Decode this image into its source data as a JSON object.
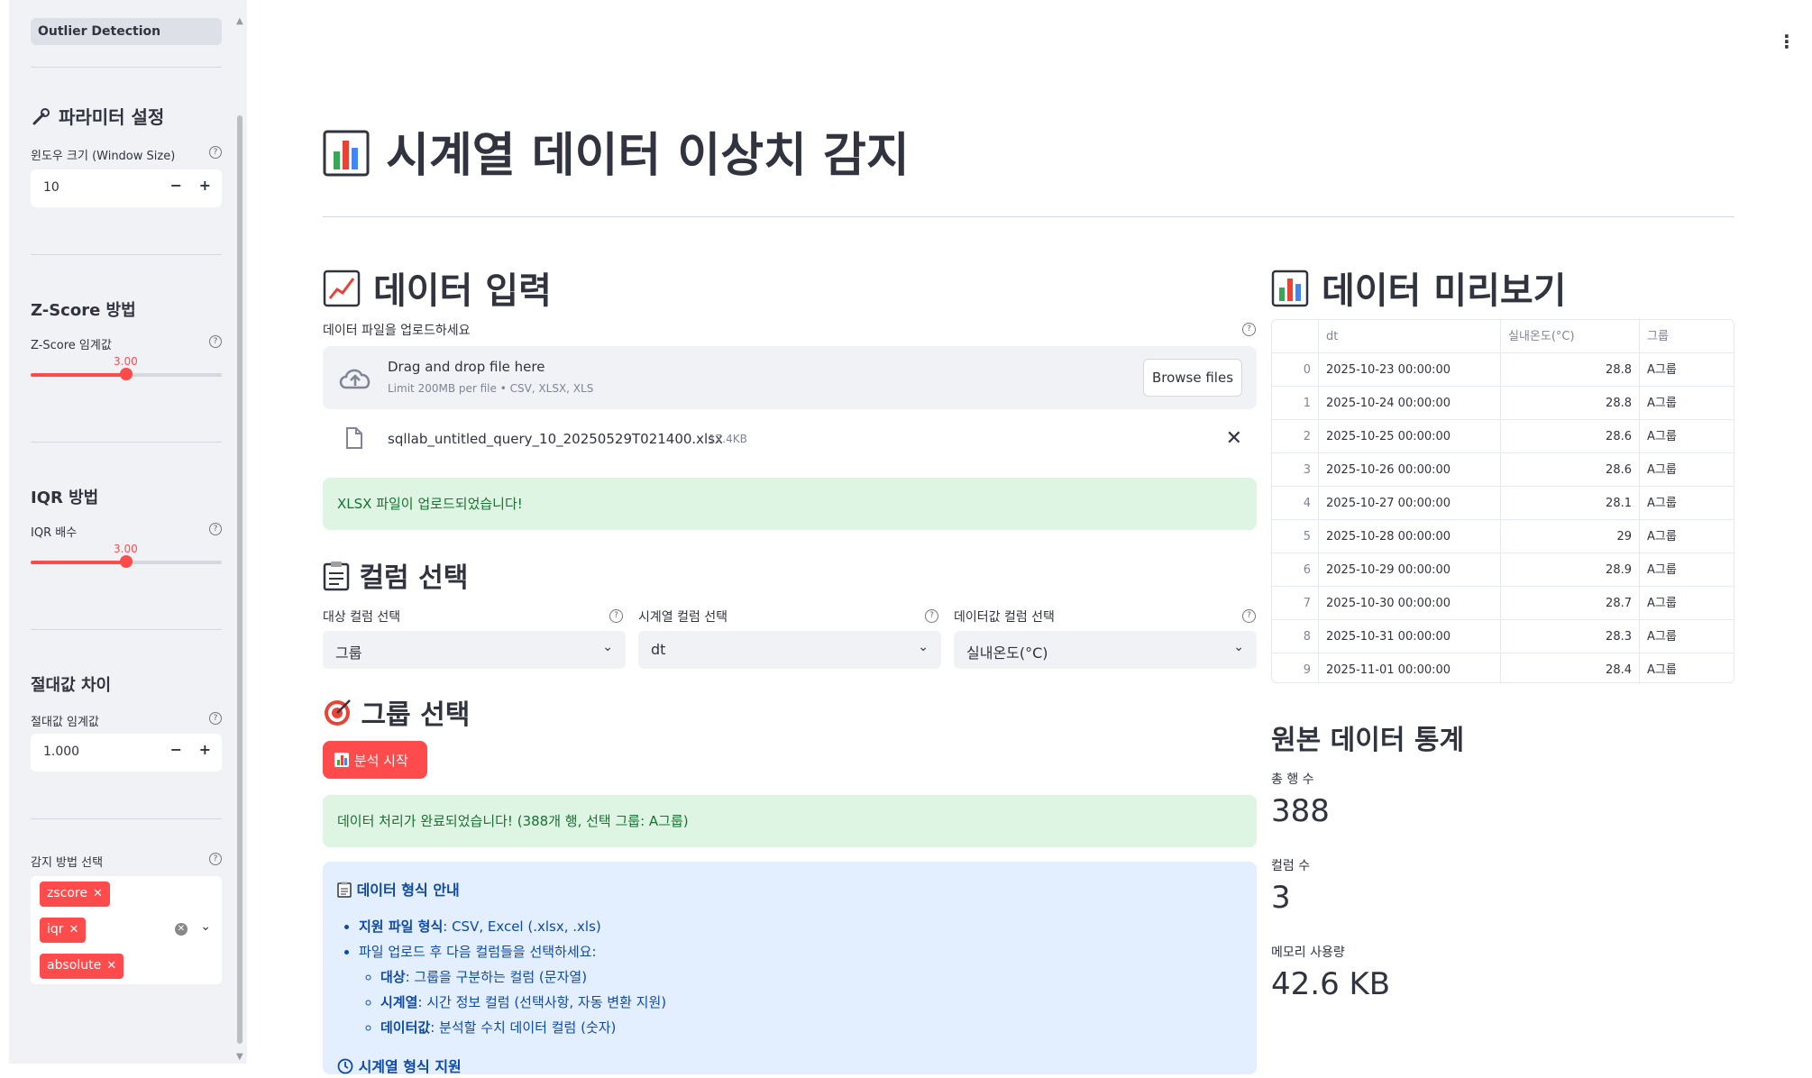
{
  "sidebar": {
    "nav_item": "Outlier Detection",
    "param_heading": "파라미터 설정",
    "window_label": "윈도우 크기 (Window Size)",
    "window_value": "10",
    "zscore_heading": "Z-Score 방법",
    "zscore_label": "Z-Score 임계값",
    "zscore_value": "3.00",
    "zscore_fraction": 0.5,
    "iqr_heading": "IQR 방법",
    "iqr_label": "IQR 배수",
    "iqr_value": "3.00",
    "iqr_fraction": 0.5,
    "abs_heading": "절대값 차이",
    "abs_label": "절대값 임계값",
    "abs_value": "1.000",
    "method_label": "감지 방법 선택",
    "methods": [
      "zscore",
      "iqr",
      "absolute"
    ]
  },
  "main": {
    "title": "시계열 데이터 이상치 감지",
    "input_heading": "데이터 입력",
    "upload_label": "데이터 파일을 업로드하세요",
    "drop_text": "Drag and drop file here",
    "drop_limit": "Limit 200MB per file • CSV, XLSX, XLS",
    "browse_label": "Browse files",
    "file_name": "sqllab_untitled_query_10_20250529T021400.xlsx",
    "file_size": "17.4KB",
    "upload_success": "XLSX 파일이 업로드되었습니다!",
    "column_heading": "컬럼 선택",
    "target_label": "대상 컬럼 선택",
    "target_value": "그룹",
    "time_label": "시계열 컬럼 선택",
    "time_value": "dt",
    "value_label": "데이터값 컬럼 선택",
    "value_value": "실내온도(°C)",
    "group_heading": "그룹 선택",
    "start_button": "분석 시작",
    "process_success": "데이터 처리가 완료되었습니다! (388개 행, 선택 그룹: A그룹)",
    "info_title": "데이터 형식 안내",
    "info_items": [
      {
        "bold": "지원 파일 형식",
        "text": ": CSV, Excel (.xlsx, .xls)"
      },
      {
        "bold": "",
        "text": "파일 업로드 후 다음 컬럼들을 선택하세요:"
      }
    ],
    "info_sub": [
      {
        "bold": "대상",
        "text": ": 그룹을 구분하는 컬럼 (문자열)"
      },
      {
        "bold": "시계열",
        "text": ": 시간 정보 컬럼 (선택사항, 자동 변환 지원)"
      },
      {
        "bold": "데이터값",
        "text": ": 분석할 수치 데이터 컬럼 (숫자)"
      }
    ],
    "info_footer": "시계열 형식 지원"
  },
  "preview": {
    "heading": "데이터 미리보기",
    "columns": [
      "",
      "dt",
      "실내온도(°C)",
      "그룹"
    ],
    "rows": [
      [
        "0",
        "2025-10-23 00:00:00",
        "28.8",
        "A그룹"
      ],
      [
        "1",
        "2025-10-24 00:00:00",
        "28.8",
        "A그룹"
      ],
      [
        "2",
        "2025-10-25 00:00:00",
        "28.6",
        "A그룹"
      ],
      [
        "3",
        "2025-10-26 00:00:00",
        "28.6",
        "A그룹"
      ],
      [
        "4",
        "2025-10-27 00:00:00",
        "28.1",
        "A그룹"
      ],
      [
        "5",
        "2025-10-28 00:00:00",
        "29",
        "A그룹"
      ],
      [
        "6",
        "2025-10-29 00:00:00",
        "28.9",
        "A그룹"
      ],
      [
        "7",
        "2025-10-30 00:00:00",
        "28.7",
        "A그룹"
      ],
      [
        "8",
        "2025-10-31 00:00:00",
        "28.3",
        "A그룹"
      ],
      [
        "9",
        "2025-11-01 00:00:00",
        "28.4",
        "A그룹"
      ]
    ],
    "stats_heading": "원본 데이터 통계",
    "rows_label": "총 행 수",
    "rows_value": "388",
    "cols_label": "컬럼 수",
    "cols_value": "3",
    "mem_label": "메모리 사용량",
    "mem_value": "42.6 KB"
  },
  "colors": {
    "accent": "#ff4b4b",
    "success_bg": "#dff5e3",
    "info_bg": "#e3efff",
    "sidebar_bg": "#f0f2f6"
  }
}
